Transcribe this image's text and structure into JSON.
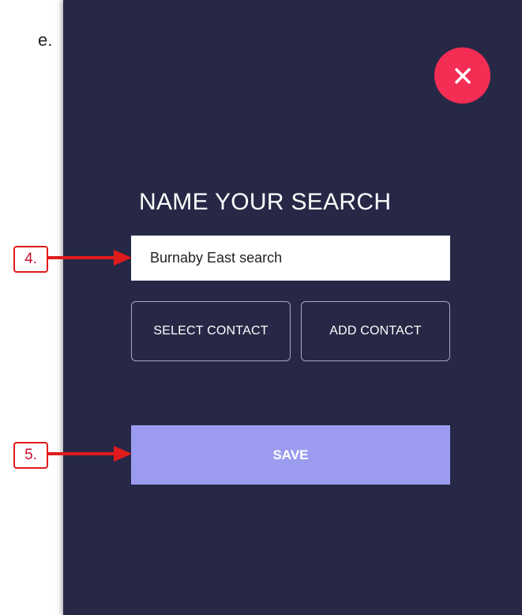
{
  "document": {
    "text_fragment": "e."
  },
  "modal": {
    "title": "NAME YOUR SEARCH",
    "close_icon": "close-icon",
    "search_name": {
      "value": "Burnaby East search",
      "placeholder": ""
    },
    "select_contact_label": "SELECT CONTACT",
    "add_contact_label": "ADD CONTACT",
    "save_label": "SAVE"
  },
  "annotations": {
    "step_4": "4.",
    "step_5": "5."
  },
  "colors": {
    "panel_bg": "#272846",
    "close_button": "#f42d55",
    "save_button": "#9b9cf0",
    "callout_red": "#e01b1b"
  }
}
